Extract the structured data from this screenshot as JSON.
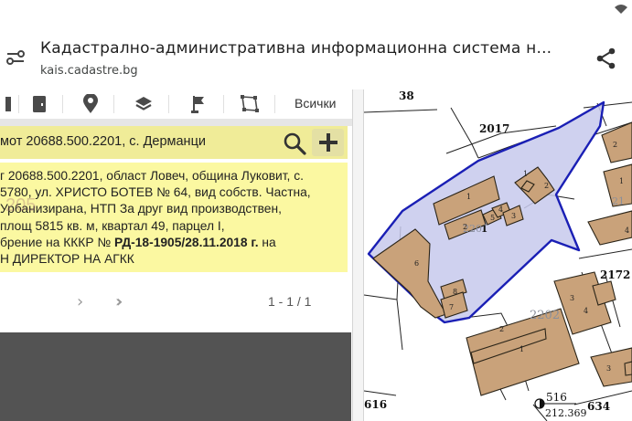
{
  "browser": {
    "title": "Кадастрално-административна информационна система н...",
    "url": "kais.cadastre.bg"
  },
  "toolbar": {
    "all_label": "Всички",
    "icons": [
      "door-icon",
      "location-pin-icon",
      "layers-icon",
      "flag-icon",
      "polygon-icon"
    ]
  },
  "search": {
    "text": "мот 20688.500.2201, с. Дерманци"
  },
  "result": {
    "lines": [
      "г 20688.500.2201, област Ловеч, община Луковит, с.",
      "5780, ул. ХРИСТО БОТЕВ № 64, вид собств. Частна,",
      "Урбанизирана, НТП За друг вид производствен,",
      "площ 5815 кв. м, квартал 49, парцел I,"
    ],
    "order_prefix": "брение на КККР №",
    "order_number": "РД-18-1905/28.11.2018 г.",
    "order_suffix": "на",
    "issuer": "Н ДИРЕКТОР НА АГКК",
    "watermark": "205"
  },
  "pager": {
    "next_symbol": "›",
    "last_symbol": "››",
    "count": "1 - 1 / 1"
  },
  "map": {
    "labels": {
      "top_number": "38",
      "road": "2017",
      "road_east": "2172",
      "left_bottom": "616",
      "bottom_mid": "516",
      "bottom_right": "634",
      "bottom_right_sub": "212.369",
      "parcel_id": "2201",
      "parcel_lot": "1",
      "neighbor_id": "2202",
      "right_partial": "21"
    },
    "buildings": [
      "1",
      "2",
      "3",
      "4",
      "5",
      "6",
      "7",
      "8",
      "1",
      "2",
      "3",
      "4",
      "1",
      "2",
      "2",
      "1",
      "3",
      "4"
    ],
    "colors": {
      "parcel_fill": "#c7c9ec",
      "parcel_stroke": "#1a1fb5",
      "building_fill": "#c9a27a",
      "building_stroke": "#2a2418"
    }
  }
}
